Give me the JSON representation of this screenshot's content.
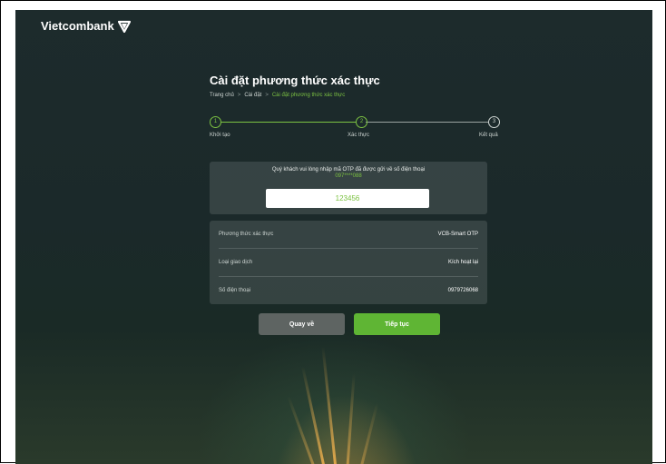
{
  "brand": {
    "name": "Vietcombank",
    "logo_icon": "vcb-logo-icon"
  },
  "page": {
    "title": "Cài đặt phương thức xác thực"
  },
  "breadcrumb": {
    "items": [
      "Trang chủ",
      "Cài đặt",
      "Cài đặt phương thức xác thực"
    ],
    "separator": ">"
  },
  "stepper": {
    "steps": [
      {
        "number": "1",
        "label": "Khởi tạo",
        "state": "done"
      },
      {
        "number": "2",
        "label": "Xác thực",
        "state": "active"
      },
      {
        "number": "3",
        "label": "Kết quả",
        "state": "todo"
      }
    ]
  },
  "otp": {
    "message": "Quý khách vui lòng nhập mã OTP đã được gửi về số điện thoại",
    "masked_phone": "097****088",
    "value": "123456"
  },
  "details": {
    "rows": [
      {
        "label": "Phương thức xác thực",
        "value": "VCB-Smart OTP"
      },
      {
        "label": "Loại giao dịch",
        "value": "Kích hoạt lại"
      },
      {
        "label": "Số điện thoại",
        "value": "0979726068"
      }
    ]
  },
  "actions": {
    "back_label": "Quay về",
    "next_label": "Tiếp tục"
  },
  "colors": {
    "accent": "#7cc242",
    "primary_button": "#5fb534",
    "secondary_button": "#5e6462",
    "background": "#1d2b2c"
  }
}
